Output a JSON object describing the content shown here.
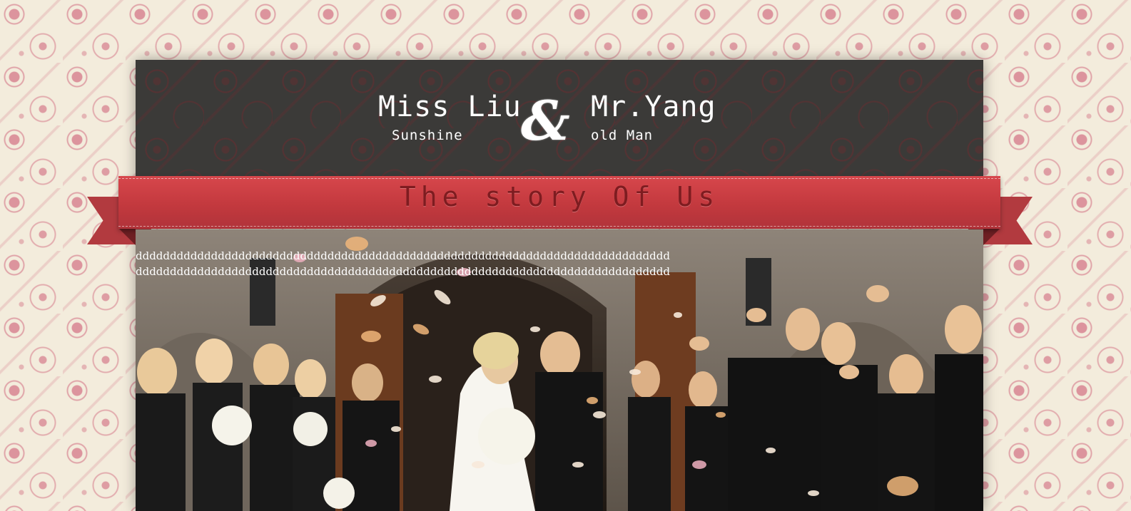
{
  "header": {
    "bride_name": "Miss Liu",
    "bride_nickname": "Sunshine",
    "ampersand": "&",
    "groom_name": "Mr.Yang",
    "groom_nickname": "old Man"
  },
  "banner": {
    "title": "The story Of Us"
  },
  "story": {
    "lines": [
      "dddddddddddddddddddddddddddddddddddddddddddddddddddddddddddddddddddddddddddddd",
      "dddddddddddddddddddddddddddddddddddddddddddddddddddddddddddddddddddddddddddddd"
    ]
  },
  "colors": {
    "page_background": "#f3ecdc",
    "pattern": "#c94d6a",
    "header_background": "#3b3a38",
    "ribbon": "#c3393e",
    "ribbon_text": "#7e1c20"
  },
  "images": {
    "hero_photo": "wedding-kiss-photo"
  }
}
